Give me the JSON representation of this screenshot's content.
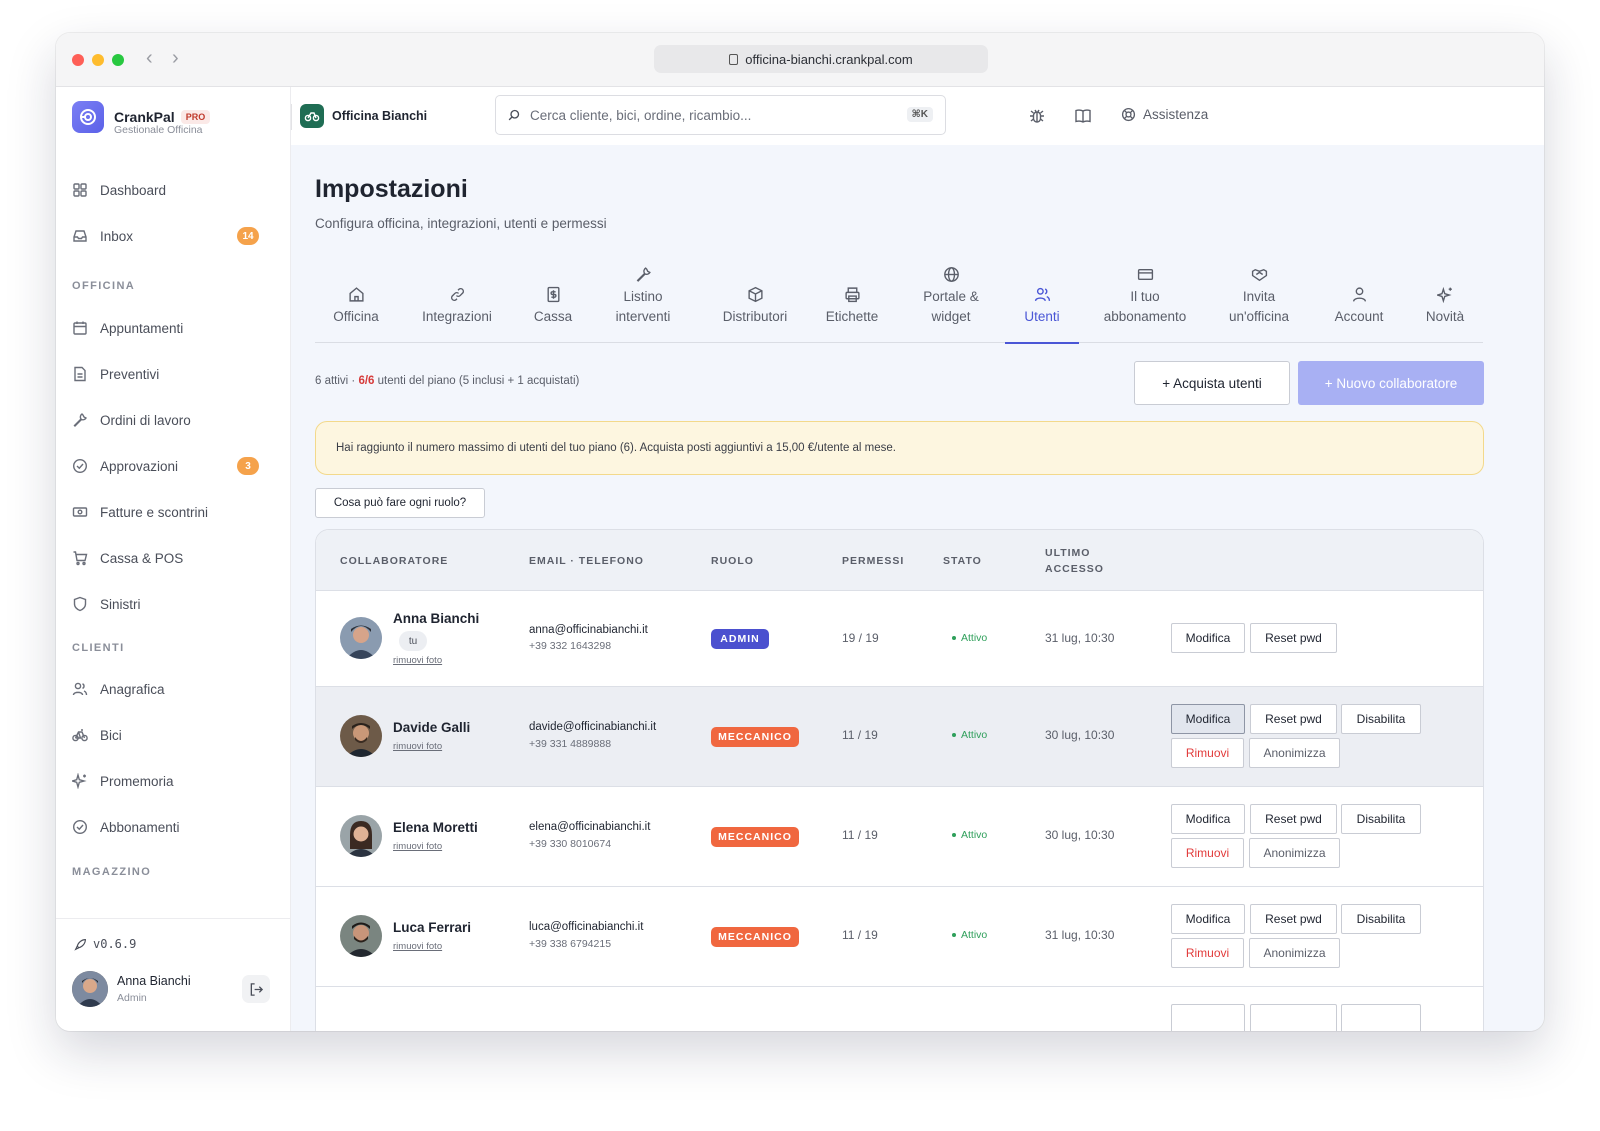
{
  "browser": {
    "url": "officina-bianchi.crankpal.com"
  },
  "brand": {
    "name": "CrankPal",
    "badge": "PRO",
    "subtitle": "Gestionale Officina"
  },
  "shop": {
    "name": "Officina Bianchi"
  },
  "search": {
    "placeholder": "Cerca cliente, bici, ordine, ricambio...",
    "shortcut": "⌘K"
  },
  "header": {
    "help_label": "Assistenza"
  },
  "sidebar": {
    "top_items": [
      {
        "label": "Dashboard",
        "icon": "grid-icon"
      },
      {
        "label": "Inbox",
        "icon": "inbox-icon",
        "badge": "14"
      }
    ],
    "sections": [
      {
        "title": "OFFICINA",
        "items": [
          {
            "label": "Appuntamenti",
            "icon": "calendar-icon"
          },
          {
            "label": "Preventivi",
            "icon": "document-icon"
          },
          {
            "label": "Ordini di lavoro",
            "icon": "wrench-icon"
          },
          {
            "label": "Approvazioni",
            "icon": "check-circle-icon",
            "badge": "3"
          },
          {
            "label": "Fatture e scontrini",
            "icon": "banknote-icon"
          },
          {
            "label": "Cassa & POS",
            "icon": "cart-icon"
          },
          {
            "label": "Sinistri",
            "icon": "shield-icon"
          }
        ]
      },
      {
        "title": "CLIENTI",
        "items": [
          {
            "label": "Anagrafica",
            "icon": "users-icon"
          },
          {
            "label": "Bici",
            "icon": "bike-icon"
          },
          {
            "label": "Promemoria",
            "icon": "sparkle-icon"
          },
          {
            "label": "Abbonamenti",
            "icon": "check-circle-icon"
          }
        ]
      },
      {
        "title": "MAGAZZINO",
        "items": []
      }
    ],
    "version": "v0.6.9",
    "user": {
      "name": "Anna Bianchi",
      "role": "Admin"
    }
  },
  "page": {
    "title": "Impostazioni",
    "subtitle": "Configura officina, integrazioni, utenti e permessi"
  },
  "tabs": [
    {
      "label": "Officina",
      "icon": "home-icon"
    },
    {
      "label": "Integrazioni",
      "icon": "link-icon"
    },
    {
      "label": "Cassa",
      "icon": "receipt-icon"
    },
    {
      "label": "Listino interventi",
      "icon": "wrench-icon"
    },
    {
      "label": "Distributori",
      "icon": "box-icon"
    },
    {
      "label": "Etichette",
      "icon": "printer-icon"
    },
    {
      "label": "Portale & widget",
      "icon": "globe-icon"
    },
    {
      "label": "Utenti",
      "icon": "users-icon",
      "active": true
    },
    {
      "label": "Il tuo abbonamento",
      "icon": "card-icon"
    },
    {
      "label": "Invita un'officina",
      "icon": "handshake-icon"
    },
    {
      "label": "Account",
      "icon": "user-icon"
    },
    {
      "label": "Novità",
      "icon": "sparkle-icon"
    }
  ],
  "users_summary": {
    "active": "6 attivi · ",
    "count": "6/6",
    "rest": " utenti del piano (5 inclusi + 1 acquistati)"
  },
  "actions": {
    "buy_users": "+ Acquista utenti",
    "new_collaborator": "+ Nuovo collaboratore",
    "roles_help": "Cosa può fare ogni ruolo?"
  },
  "alert": {
    "text": "Hai raggiunto il numero massimo di utenti del tuo piano (6). Acquista posti aggiuntivi a 15,00 €/utente al mese."
  },
  "table": {
    "columns": [
      "COLLABORATORE",
      "EMAIL · TELEFONO",
      "RUOLO",
      "PERMESSI",
      "STATO",
      "ULTIMO ACCESSO"
    ],
    "rows": [
      {
        "name": "Anna Bianchi",
        "you": "tu",
        "remove_photo": "rimuovi foto",
        "email": "anna@officinabianchi.it",
        "phone": "+39 332 1643298",
        "role": "ADMIN",
        "permissions": "19 / 19",
        "status": "Attivo",
        "last_access": "31 lug, 10:30",
        "actions": [
          "Modifica",
          "Reset pwd"
        ]
      },
      {
        "name": "Davide Galli",
        "remove_photo": "rimuovi foto",
        "email": "davide@officinabianchi.it",
        "phone": "+39 331 4889888",
        "role": "MECCANICO",
        "permissions": "11 / 19",
        "status": "Attivo",
        "last_access": "30 lug, 10:30",
        "actions": [
          "Modifica",
          "Reset pwd",
          "Disabilita",
          "Rimuovi",
          "Anonimizza"
        ]
      },
      {
        "name": "Elena Moretti",
        "remove_photo": "rimuovi foto",
        "email": "elena@officinabianchi.it",
        "phone": "+39 330 8010674",
        "role": "MECCANICO",
        "permissions": "11 / 19",
        "status": "Attivo",
        "last_access": "30 lug, 10:30",
        "actions": [
          "Modifica",
          "Reset pwd",
          "Disabilita",
          "Rimuovi",
          "Anonimizza"
        ]
      },
      {
        "name": "Luca Ferrari",
        "remove_photo": "rimuovi foto",
        "email": "luca@officinabianchi.it",
        "phone": "+39 338 6794215",
        "role": "MECCANICO",
        "permissions": "11 / 19",
        "status": "Attivo",
        "last_access": "31 lug, 10:30",
        "actions": [
          "Modifica",
          "Reset pwd",
          "Disabilita",
          "Rimuovi",
          "Anonimizza"
        ]
      }
    ]
  },
  "colors": {
    "accent": "#4a56d6",
    "admin_badge": "#4b50cf",
    "mechanic_badge": "#f0673f",
    "nav_badge": "#f5a24b",
    "status_active": "#2e9f5a",
    "danger": "#e23b3b"
  }
}
